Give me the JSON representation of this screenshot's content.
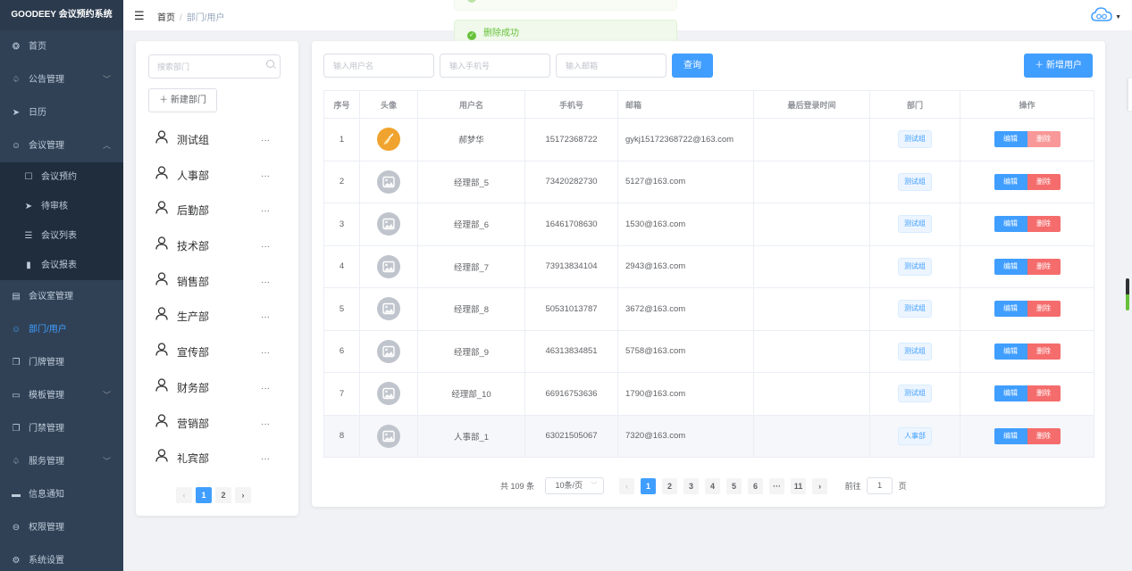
{
  "app": {
    "title": "GOODEEY 会议预约系统"
  },
  "sidebar": {
    "items": [
      {
        "label": "首页",
        "icon": "dashboard-icon",
        "glyph": "❂"
      },
      {
        "label": "公告管理",
        "icon": "bell-icon",
        "glyph": "♤",
        "arrow": "﹀"
      },
      {
        "label": "日历",
        "icon": "send-icon",
        "glyph": "➤"
      },
      {
        "label": "会议管理",
        "icon": "user-icon",
        "glyph": "☺",
        "arrow": "︿"
      },
      {
        "label": "会议预约",
        "icon": "edit-icon",
        "glyph": "☐",
        "sub": true
      },
      {
        "label": "待审核",
        "icon": "send-icon",
        "glyph": "➤",
        "sub": true
      },
      {
        "label": "会议列表",
        "icon": "list-icon",
        "glyph": "☰",
        "sub": true
      },
      {
        "label": "会议报表",
        "icon": "bar-chart-icon",
        "glyph": "▮",
        "sub": true
      },
      {
        "label": "会议室管理",
        "icon": "room-icon",
        "glyph": "▤"
      },
      {
        "label": "部门/用户",
        "icon": "user-icon",
        "glyph": "☺",
        "active": true
      },
      {
        "label": "门牌管理",
        "icon": "copy-icon",
        "glyph": "❐"
      },
      {
        "label": "模板管理",
        "icon": "briefcase-icon",
        "glyph": "▭",
        "arrow": "﹀"
      },
      {
        "label": "门禁管理",
        "icon": "copy-icon",
        "glyph": "❐"
      },
      {
        "label": "服务管理",
        "icon": "bell-icon",
        "glyph": "♤",
        "arrow": "﹀"
      },
      {
        "label": "信息通知",
        "icon": "chat-icon",
        "glyph": "▬"
      },
      {
        "label": "权限管理",
        "icon": "lock-icon",
        "glyph": "⊖"
      },
      {
        "label": "系统设置",
        "icon": "gear-icon",
        "glyph": "⚙"
      }
    ]
  },
  "breadcrumb": {
    "home": "首页",
    "sep": "/",
    "current": "部门/用户"
  },
  "toast": {
    "message": "删除成功"
  },
  "dept_panel": {
    "search_placeholder": "搜索部门",
    "new_button": "＋ 新建部门",
    "more": "···",
    "departments": [
      "测试组",
      "人事部",
      "后勤部",
      "技术部",
      "销售部",
      "生产部",
      "宣传部",
      "财务部",
      "营销部",
      "礼宾部"
    ],
    "pager": {
      "prev": "‹",
      "pages": [
        "1",
        "2"
      ],
      "current": "1",
      "next": "›"
    }
  },
  "user_panel": {
    "username_placeholder": "输入用户名",
    "phone_placeholder": "输入手机号",
    "email_placeholder": "输入邮箱",
    "query_button": "查询",
    "add_button": "＋ 新增用户",
    "columns": [
      "序号",
      "头像",
      "用户名",
      "手机号",
      "邮箱",
      "最后登录时间",
      "部门",
      "操作"
    ],
    "edit_label": "编辑",
    "delete_label": "删除",
    "rows": [
      {
        "no": "1",
        "name": "郝梦华",
        "phone": "15172368722",
        "email": "gykj15172368722@163.com",
        "last_login": "",
        "dept": "测试组",
        "avatar": "custom"
      },
      {
        "no": "2",
        "name": "经理部_5",
        "phone": "73420282730",
        "email": "5127@163.com",
        "last_login": "",
        "dept": "测试组",
        "avatar": "default"
      },
      {
        "no": "3",
        "name": "经理部_6",
        "phone": "16461708630",
        "email": "1530@163.com",
        "last_login": "",
        "dept": "测试组",
        "avatar": "default"
      },
      {
        "no": "4",
        "name": "经理部_7",
        "phone": "73913834104",
        "email": "2943@163.com",
        "last_login": "",
        "dept": "测试组",
        "avatar": "default"
      },
      {
        "no": "5",
        "name": "经理部_8",
        "phone": "50531013787",
        "email": "3672@163.com",
        "last_login": "",
        "dept": "测试组",
        "avatar": "default"
      },
      {
        "no": "6",
        "name": "经理部_9",
        "phone": "46313834851",
        "email": "5758@163.com",
        "last_login": "",
        "dept": "测试组",
        "avatar": "default"
      },
      {
        "no": "7",
        "name": "经理部_10",
        "phone": "66916753636",
        "email": "1790@163.com",
        "last_login": "",
        "dept": "测试组",
        "avatar": "default"
      },
      {
        "no": "8",
        "name": "人事部_1",
        "phone": "63021505067",
        "email": "7320@163.com",
        "last_login": "",
        "dept": "人事部",
        "avatar": "default"
      }
    ],
    "pager": {
      "total": "共 109 条",
      "page_size": "10条/页",
      "prev": "‹",
      "pages": [
        "1",
        "2",
        "3",
        "4",
        "5",
        "6",
        "···",
        "11"
      ],
      "current": "1",
      "next": "›",
      "goto_label": "前往",
      "goto_value": "1",
      "page_unit": "页"
    }
  },
  "colors": {
    "primary": "#409eff",
    "danger": "#f56c6c",
    "success": "#67c23a",
    "sidebar_bg": "#304156"
  }
}
